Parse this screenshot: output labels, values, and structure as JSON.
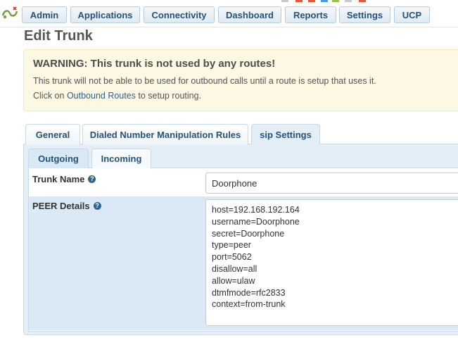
{
  "nav": {
    "items": [
      {
        "label": "Admin"
      },
      {
        "label": "Applications"
      },
      {
        "label": "Connectivity"
      },
      {
        "label": "Dashboard"
      },
      {
        "label": "Reports"
      },
      {
        "label": "Settings"
      },
      {
        "label": "UCP"
      }
    ],
    "logo_icon": "freepbx-logo-icon"
  },
  "page": {
    "title": "Edit Trunk"
  },
  "warning": {
    "title": "WARNING: This trunk is not used by any routes!",
    "line1": "This trunk will not be able to be used for outbound calls until a route is setup that uses it.",
    "line2_prefix": "Click on ",
    "line2_link": "Outbound Routes",
    "line2_suffix": " to setup routing."
  },
  "tabs": [
    {
      "label": "General"
    },
    {
      "label": "Dialed Number Manipulation Rules"
    },
    {
      "label": "sip Settings",
      "active": true
    }
  ],
  "subtabs": [
    {
      "label": "Outgoing",
      "active": true
    },
    {
      "label": "Incoming"
    }
  ],
  "form": {
    "trunk_name_label": "Trunk Name",
    "trunk_name_value": "Doorphone",
    "peer_details_label": "PEER Details",
    "peer_details_value": "host=192.168.192.164\nusername=Doorphone\nsecret=Doorphone\ntype=peer\nport=5062\ndisallow=all\nallow=ulaw\ndtmfmode=rfc2833\ncontext=from-trunk",
    "help_icon_glyph": "?"
  },
  "colors": {
    "accent": "#24527a",
    "warning_bg": "#fcf8e3",
    "panel_bg": "#e3eef7"
  }
}
